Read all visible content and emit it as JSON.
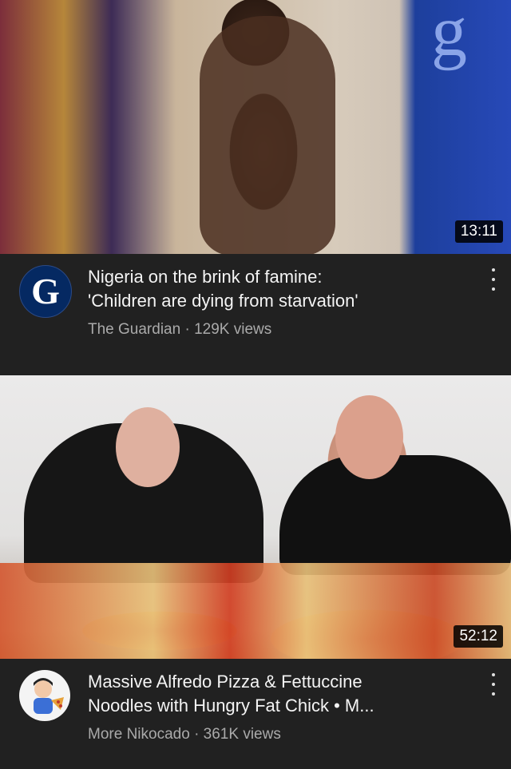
{
  "videos": [
    {
      "duration": "13:11",
      "title_line1": "Nigeria on the brink of famine:",
      "title_line2": "'Children are dying from starvation'",
      "channel": "The Guardian",
      "separator": "·",
      "views": "129K views",
      "avatar_letter": "G",
      "avatar_icon": "guardian-logo-icon",
      "menu_icon": "more-vert-icon"
    },
    {
      "duration": "52:12",
      "title_line1": "Massive Alfredo Pizza & Fettuccine",
      "title_line2": "Noodles with Hungry Fat Chick • M...",
      "channel": "More Nikocado",
      "separator": "·",
      "views": "361K views",
      "avatar_icon": "cartoon-avatar-icon",
      "menu_icon": "more-vert-icon"
    }
  ],
  "colors": {
    "background": "#212121",
    "title": "#f4f4f4",
    "subtitle": "#aaaaaa",
    "duration_bg": "#000000"
  }
}
